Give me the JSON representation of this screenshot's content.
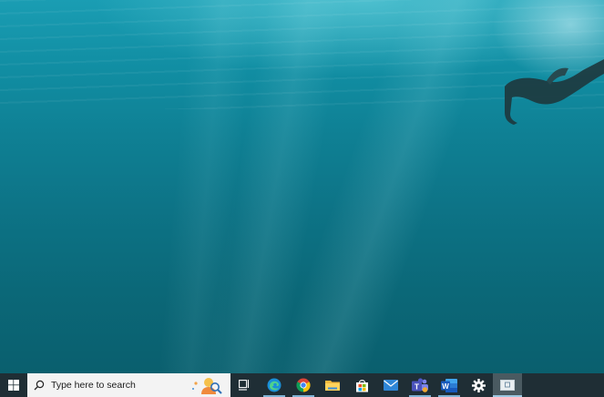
{
  "desktop": {
    "wallpaper": "underwater-swimmer"
  },
  "taskbar": {
    "background": "#1f2e35",
    "start": {
      "icon": "windows-logo-icon"
    },
    "search": {
      "icon": "search-icon",
      "placeholder": "Type here to search",
      "highlight_icon": "search-highlight-icon"
    },
    "apps": [
      {
        "name": "Task View",
        "icon": "task-view-icon",
        "running": false
      },
      {
        "name": "Microsoft Edge",
        "icon": "edge-icon",
        "running": true
      },
      {
        "name": "Google Chrome",
        "icon": "chrome-icon",
        "running": true
      },
      {
        "name": "File Explorer",
        "icon": "file-explorer-icon",
        "running": false
      },
      {
        "name": "Microsoft Store",
        "icon": "store-icon",
        "running": false
      },
      {
        "name": "Mail",
        "icon": "mail-icon",
        "running": false
      },
      {
        "name": "Microsoft Teams",
        "icon": "teams-icon",
        "running": true
      },
      {
        "name": "Microsoft Word",
        "icon": "word-icon",
        "running": true
      },
      {
        "name": "Settings",
        "icon": "gear-icon",
        "running": false
      },
      {
        "name": "Active window",
        "icon": "window-icon",
        "running": true,
        "active": true
      }
    ]
  }
}
